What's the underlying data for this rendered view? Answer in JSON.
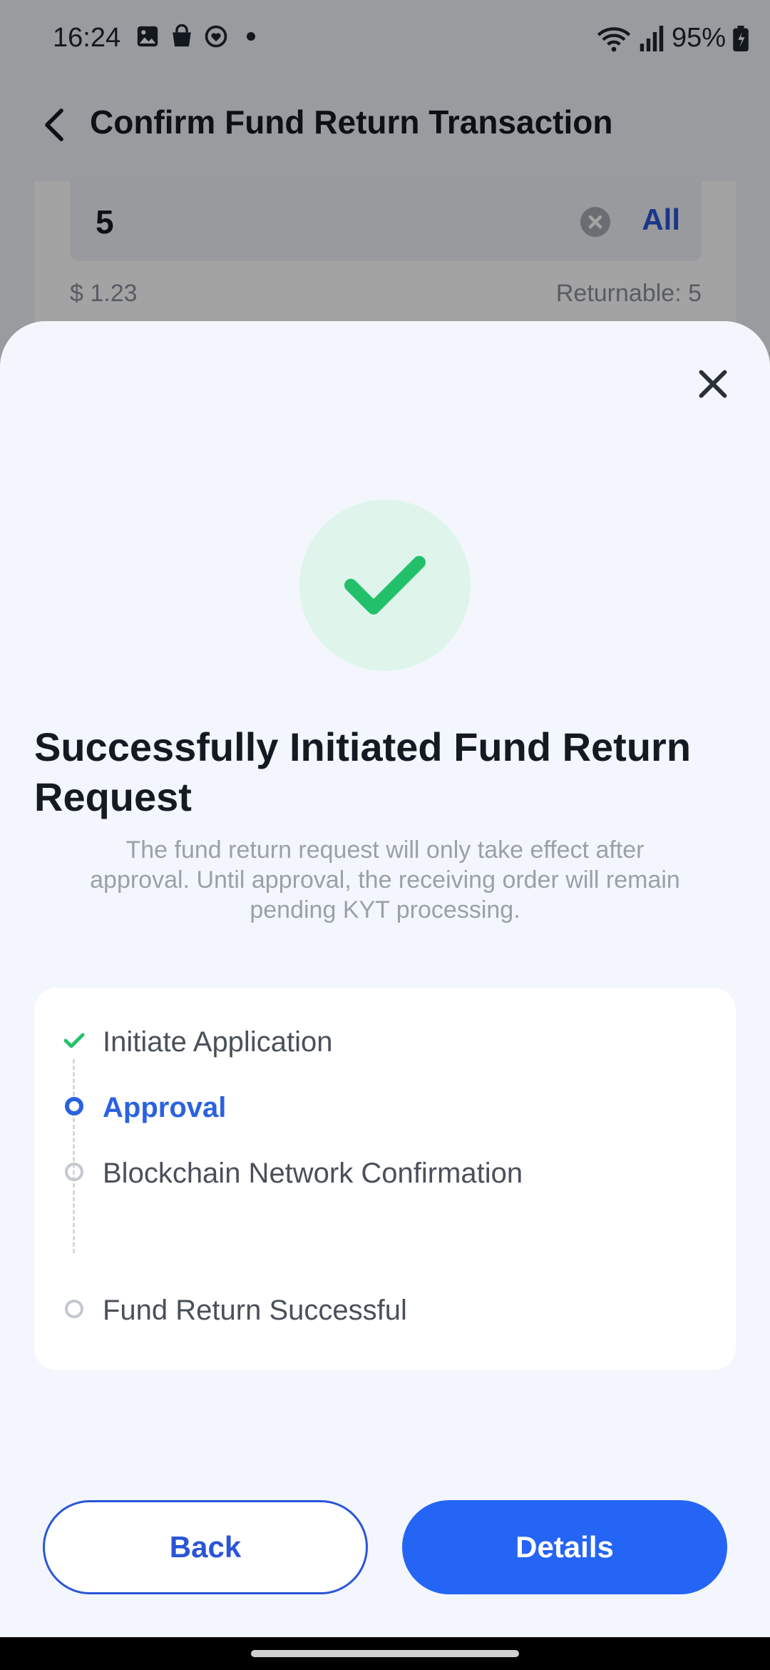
{
  "status_bar": {
    "time": "16:24",
    "battery": "95%",
    "icons_left": [
      "gallery-icon",
      "shopping-bag-icon",
      "heart-circle-icon"
    ],
    "icons_right": [
      "wifi-icon",
      "signal-icon",
      "battery-icon"
    ]
  },
  "header": {
    "title": "Confirm Fund Return Transaction"
  },
  "amount": {
    "value": "5",
    "all_label": "All",
    "usd_value": "$ 1.23",
    "returnable": "Returnable: 5"
  },
  "sheet": {
    "title": "Successfully Initiated Fund Return Request",
    "description": "The fund return request will only take effect after approval. Until approval, the receiving order will remain pending KYT processing.",
    "steps": [
      {
        "label": "Initiate Application",
        "state": "done"
      },
      {
        "label": "Approval",
        "state": "active"
      },
      {
        "label": "Blockchain Network Confirmation",
        "state": "pending"
      },
      {
        "label": "Fund Return Successful",
        "state": "pending"
      }
    ],
    "back_label": "Back",
    "details_label": "Details"
  },
  "colors": {
    "primary": "#2465f6",
    "success": "#22c06a",
    "success_bg": "#dff5ec"
  }
}
